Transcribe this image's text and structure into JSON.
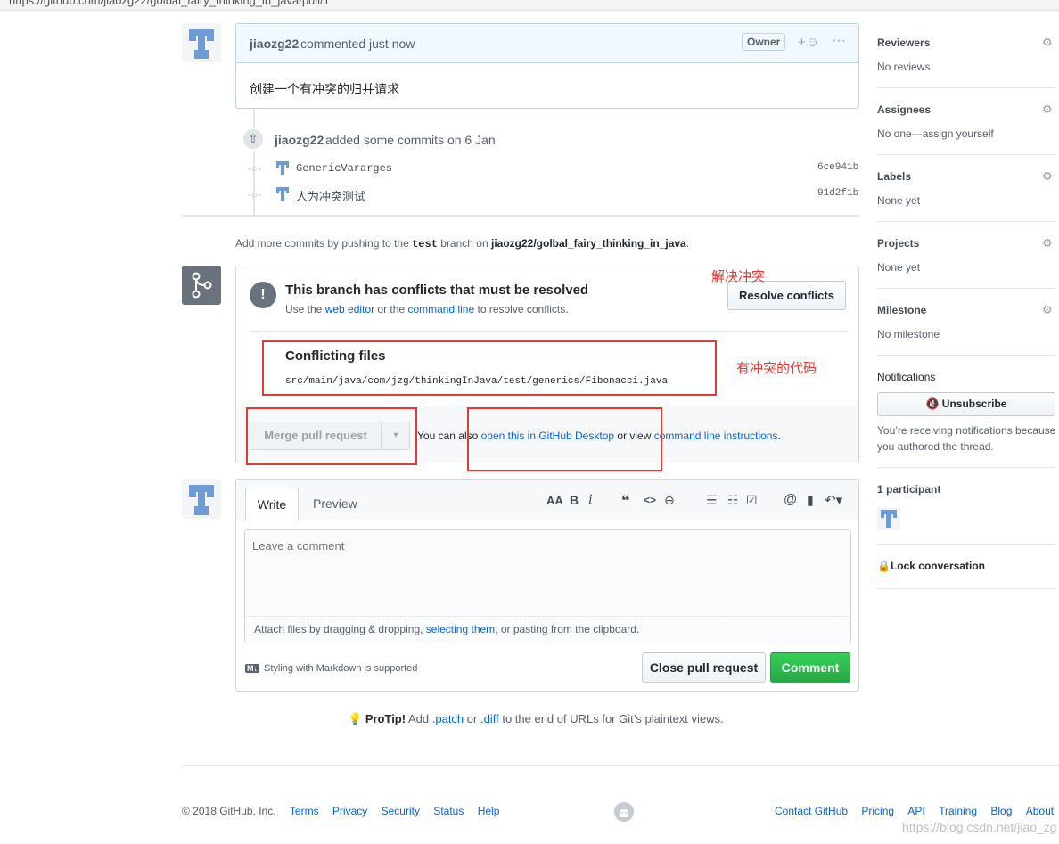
{
  "browser": {
    "url": "https://github.com/jiaozg22/golbal_fairy_thinking_in_java/pull/1"
  },
  "comment": {
    "author": "jiaozg22",
    "action": "commented just now",
    "owner_badge": "Owner",
    "body": "创建一个有冲突的归并请求"
  },
  "commits": {
    "author": "jiaozg22",
    "summary": "added some commits on 6 Jan",
    "items": [
      {
        "message": "GenericVararges",
        "sha": "6ce941b"
      },
      {
        "message": "人为冲突测试",
        "sha": "91d2f1b"
      }
    ]
  },
  "push_hint": {
    "prefix": "Add more commits by pushing to the",
    "branch": "test",
    "middle": "branch on",
    "repo": "jiaozg22/golbal_fairy_thinking_in_java",
    "suffix": "."
  },
  "merge": {
    "title": "This branch has conflicts that must be resolved",
    "sub_prefix": "Use the",
    "web_editor": "web editor",
    "sub_or": "or the",
    "command_line": "command line",
    "sub_suffix": "to resolve conflicts.",
    "resolve_button": "Resolve conflicts",
    "conflicting_title": "Conflicting files",
    "conflicting_file": "src/main/java/com/jzg/thinkingInJava/test/generics/Fibonacci.java",
    "merge_button": "Merge pull request",
    "also_prefix": "You can also",
    "desktop_link": "open this in GitHub Desktop",
    "also_or": "or view",
    "cli_link": "command line instructions",
    "also_suffix": "."
  },
  "annotations": {
    "resolve": "解决冲突",
    "conflict_code": "有冲突的代码"
  },
  "editor": {
    "tab_write": "Write",
    "tab_preview": "Preview",
    "toolbar": {
      "heading": "AA",
      "bold": "B",
      "italic": "i",
      "quote": "❝",
      "code": "<>",
      "link": "⊖",
      "ul": "☰",
      "ol": "☷",
      "tasks": "☑",
      "mention": "@",
      "bookmark": "▮",
      "reply": "↶▾"
    },
    "placeholder": "Leave a comment",
    "attach_prefix": "Attach files by dragging & dropping,",
    "attach_link": "selecting them",
    "attach_suffix": ", or pasting from the clipboard.",
    "markdown_badge": "M↓",
    "markdown_note": "Styling with Markdown is supported",
    "close_button": "Close pull request",
    "comment_button": "Comment"
  },
  "protip": {
    "label": "ProTip!",
    "text1": "Add",
    "patch": ".patch",
    "or": "or",
    "diff": ".diff",
    "text2": "to the end of URLs for Git’s plaintext views."
  },
  "sidebar": {
    "reviewers": {
      "title": "Reviewers",
      "value": "No reviews"
    },
    "assignees": {
      "title": "Assignees",
      "value": "No one—assign yourself"
    },
    "labels": {
      "title": "Labels",
      "value": "None yet"
    },
    "projects": {
      "title": "Projects",
      "value": "None yet"
    },
    "milestone": {
      "title": "Milestone",
      "value": "No milestone"
    },
    "notifications": {
      "title": "Notifications",
      "button": "Unsubscribe",
      "desc1": "You’re receiving notifications because",
      "desc2": "you authored the thread."
    },
    "participants": "1 participant",
    "lock": "Lock conversation"
  },
  "footer": {
    "copyright": "© 2018 GitHub, Inc.",
    "left_links": [
      "Terms",
      "Privacy",
      "Security",
      "Status",
      "Help"
    ],
    "right_links": [
      "Contact GitHub",
      "Pricing",
      "API",
      "Training",
      "Blog",
      "About"
    ],
    "watermark": "https://blog.csdn.net/jiao_zg"
  },
  "colors": {
    "link": "#0366d6",
    "green": "#2cbe4e",
    "red_annotation": "#e53935",
    "avatar": "#6e9ad6"
  }
}
